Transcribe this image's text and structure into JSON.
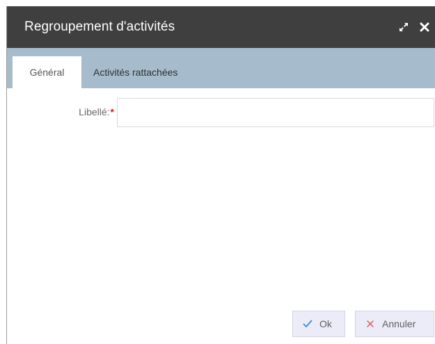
{
  "dialog": {
    "title": "Regroupement d'activités",
    "actions": {
      "maximize_icon": "expand-icon",
      "close_icon": "close-icon"
    }
  },
  "tabs": [
    {
      "label": "Général",
      "active": true
    },
    {
      "label": "Activités rattachées",
      "active": false
    }
  ],
  "form": {
    "libelle_label": "Libellé:",
    "required_marker": "*",
    "libelle_value": ""
  },
  "footer": {
    "ok_label": "Ok",
    "cancel_label": "Annuler",
    "ok_icon": "check-icon",
    "cancel_icon": "cross-icon"
  },
  "colors": {
    "titlebar": "#3f3f3f",
    "tabstrip": "#a6bccc",
    "required": "#d61f1f",
    "ok_check": "#3a8fd6",
    "cancel_cross": "#e05a5a",
    "button_bg": "#ecebf8"
  }
}
